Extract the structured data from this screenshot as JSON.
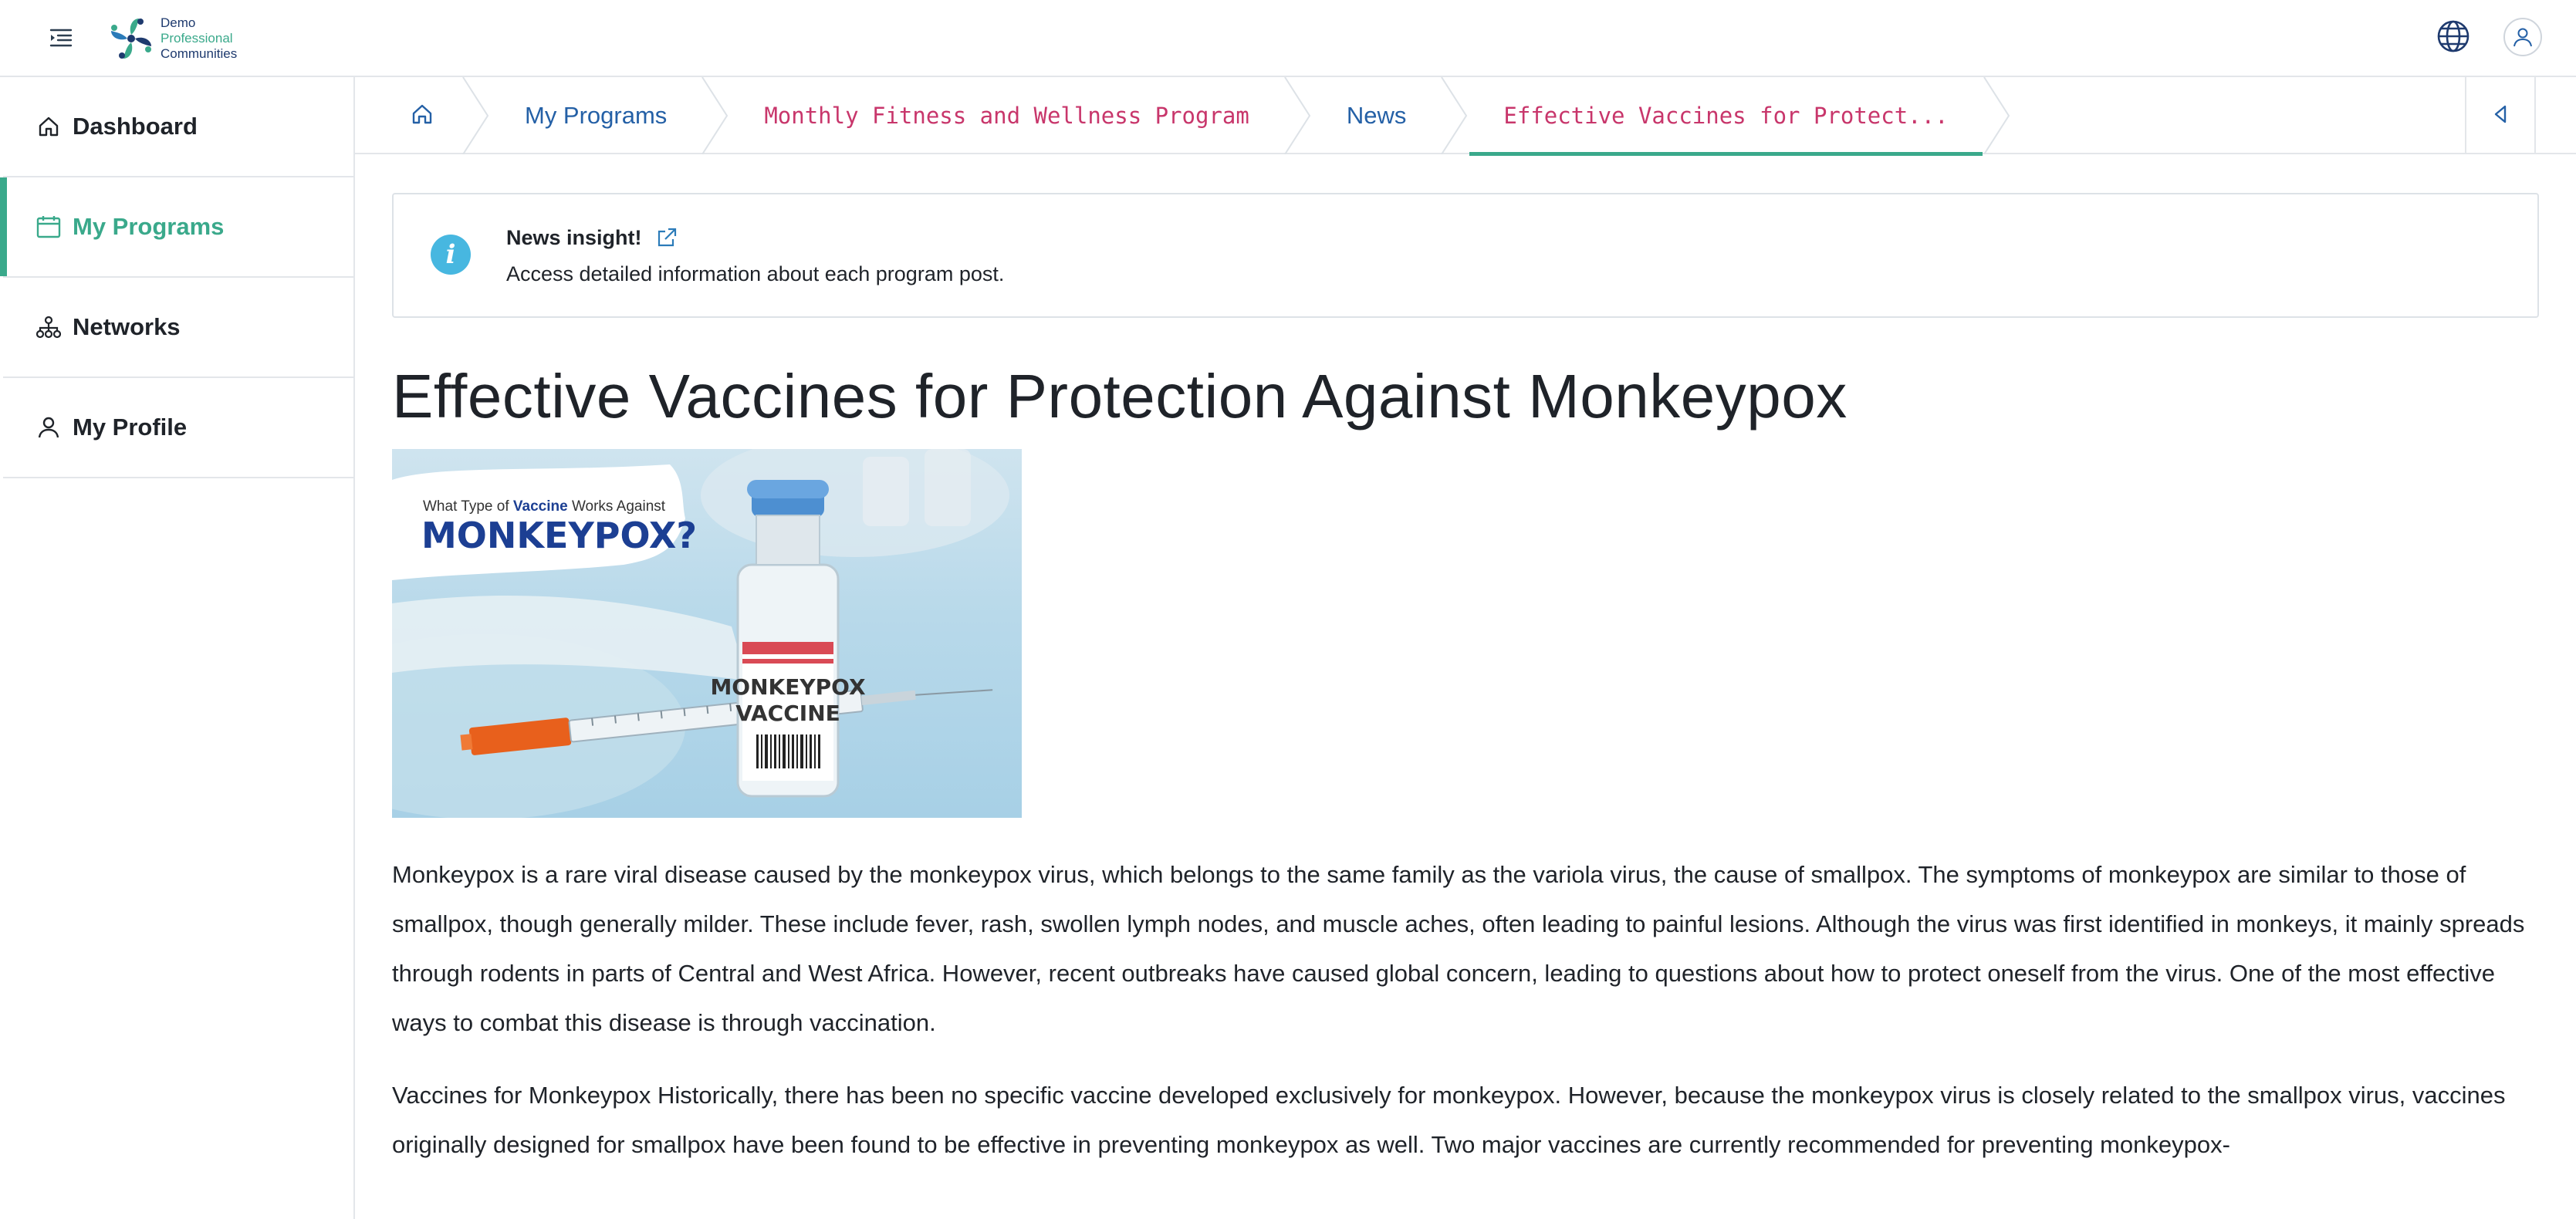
{
  "app": {
    "logo": {
      "line1": "Demo",
      "line2": "Professional",
      "line3": "Communities"
    }
  },
  "icons": {
    "menu_toggle": "menu-toggle-icon",
    "globe": "globe-icon",
    "user": "user-icon",
    "home": "home-icon",
    "back": "caret-left-icon",
    "info": "info-icon",
    "external_link": "external-link-icon"
  },
  "colors": {
    "accent": "#3aa98b",
    "link": "#2460a6",
    "mono_link": "#c8366b",
    "info": "#47b7e0"
  },
  "sidebar": {
    "items": [
      {
        "label": "Dashboard",
        "icon": "home-icon",
        "active": false
      },
      {
        "label": "My Programs",
        "icon": "calendar-icon",
        "active": true
      },
      {
        "label": "Networks",
        "icon": "network-icon",
        "active": false
      },
      {
        "label": "My Profile",
        "icon": "user-icon",
        "active": false
      }
    ]
  },
  "breadcrumb": {
    "items": [
      {
        "label": "My Programs"
      },
      {
        "label": "Monthly Fitness and Wellness Program"
      },
      {
        "label": "News"
      },
      {
        "label": "Effective Vaccines for Protect..."
      }
    ]
  },
  "insight": {
    "title": "News insight!",
    "subtitle": "Access detailed information about each program post."
  },
  "article": {
    "title": "Effective Vaccines for Protection Against Monkeypox",
    "image": {
      "caption_top_1": "What Type of ",
      "caption_top_2": "Vaccine",
      "caption_top_3": " Works Against",
      "caption_big": "MONKEYPOX?",
      "label_line1": "MONKEYPOX",
      "label_line2": "VACCINE"
    },
    "paragraphs": [
      "Monkeypox is a rare viral disease caused by the monkeypox virus, which belongs to the same family as the variola virus, the cause of smallpox. The symptoms of monkeypox are similar to those of smallpox, though generally milder. These include fever, rash, swollen lymph nodes, and muscle aches, often leading to painful lesions. Although the virus was first identified in monkeys, it mainly spreads through rodents in parts of Central and West Africa. However, recent outbreaks have caused global concern, leading to questions about how to protect oneself from the virus. One of the most effective ways to combat this disease is through vaccination.",
      "Vaccines for Monkeypox Historically, there has been no specific vaccine developed exclusively for monkeypox. However, because the monkeypox virus is closely related to the smallpox virus, vaccines originally designed for smallpox have been found to be effective in preventing monkeypox as well. Two major vaccines are currently recommended for preventing monkeypox-"
    ]
  }
}
